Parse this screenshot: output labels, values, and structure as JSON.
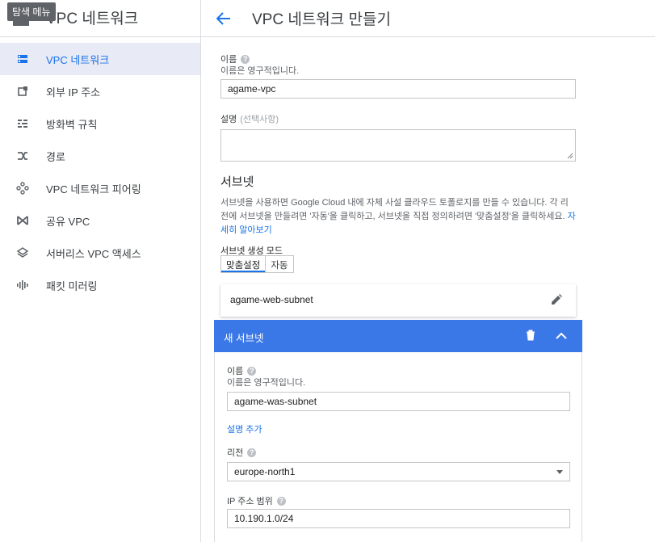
{
  "tooltip": "탐색 메뉴",
  "sidebar": {
    "title": "VPC 네트워크",
    "items": [
      {
        "label": "VPC 네트워크",
        "icon": "vpc-network-icon"
      },
      {
        "label": "외부 IP 주소",
        "icon": "external-ip-icon"
      },
      {
        "label": "방화벽 규칙",
        "icon": "firewall-icon"
      },
      {
        "label": "경로",
        "icon": "routes-icon"
      },
      {
        "label": "VPC 네트워크 피어링",
        "icon": "peering-icon"
      },
      {
        "label": "공유 VPC",
        "icon": "shared-vpc-icon"
      },
      {
        "label": "서버리스 VPC 액세스",
        "icon": "serverless-icon"
      },
      {
        "label": "패킷 미러링",
        "icon": "packet-mirroring-icon"
      }
    ],
    "active_index": 0
  },
  "header": {
    "title": "VPC 네트워크 만들기"
  },
  "form": {
    "name_label": "이름",
    "name_hint": "이름은 영구적입니다.",
    "name_value": "agame-vpc",
    "description_label": "설명",
    "description_optional": "(선택사항)",
    "subnets_title": "서브넷",
    "subnets_desc": "서브넷을 사용하면 Google Cloud 내에 자체 사설 클라우드 토폴로지를 만들 수 있습니다. 각 리전에 서브넷을 만들려면 '자동'을 클릭하고, 서브넷을 직접 정의하려면 '맞춤설정'을 클릭하세요.",
    "learn_more": "자세히 알아보기",
    "mode_label": "서브넷 생성 모드",
    "mode_options": [
      "맞춤설정",
      "자동"
    ],
    "mode_selected": "맞춤설정"
  },
  "existing_subnet": {
    "name": "agame-web-subnet"
  },
  "new_subnet": {
    "title": "새 서브넷",
    "name_label": "이름",
    "name_hint": "이름은 영구적입니다.",
    "name_value": "agame-was-subnet",
    "add_description": "설명 추가",
    "region_label": "리전",
    "region_value": "europe-north1",
    "ip_label": "IP 주소 범위",
    "ip_value": "10.190.1.0/24"
  },
  "colors": {
    "accent": "#1a73e8",
    "header_blue": "#3b78e7",
    "active_bg": "#e8eaf6"
  }
}
